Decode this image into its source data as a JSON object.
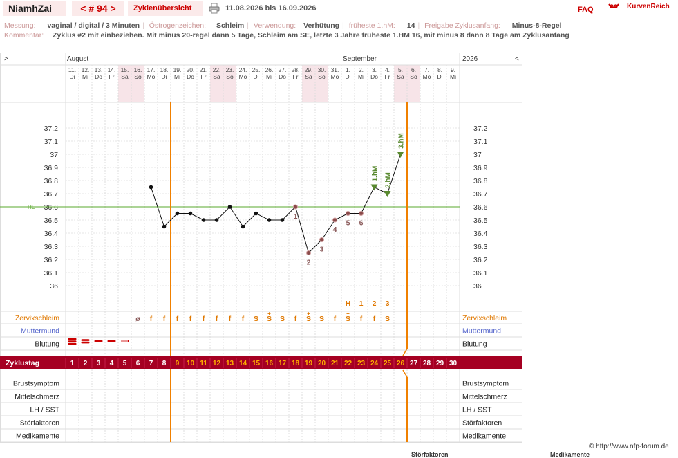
{
  "header": {
    "user": "NiamhZai",
    "cycle_nav": "< # 94 >",
    "overview_link": "Zyklenübersicht",
    "printer_icon": "printer-icon",
    "date_range": "11.08.2026 bis 16.09.2026",
    "faq": "FAQ",
    "logo_icon": "kurvenreich-logo-icon",
    "brand": "KurvenReich"
  },
  "info": {
    "messung_label": "Messung:",
    "messung_value": "vaginal / digital / 3 Minuten",
    "oestrogen_label": "Östrogenzeichen:",
    "oestrogen_value": "Schleim",
    "verwendung_label": "Verwendung:",
    "verwendung_value": "Verhütung",
    "frueheste_label": "früheste 1.hM:",
    "frueheste_value": "14",
    "freigabe_label": "Freigabe Zyklusanfang:",
    "freigabe_value": "Minus-8-Regel",
    "kommentar_label": "Kommentar:",
    "kommentar_value": "Zyklus #2  mit einbeziehen. Mit minus 20-regel dann 5 Tage,  Schleim am SE, letzte 3 Jahre früheste 1.HM 16, mit minus 8 dann 8 Tage am Zyklusanfang"
  },
  "colors": {
    "brand_red": "#cc0000",
    "cycle_bar": "#a50022",
    "weekend_shade": "#f7e4e8",
    "vertical_marker": "#f08000",
    "hl_line": "#5aa82c",
    "hm_marker": "#5a8a30",
    "mucus_orange": "#e07800",
    "muttermund_blue": "#5566cc",
    "bleeding_red": "#cc0000"
  },
  "chart_data": {
    "type": "line",
    "nav_left": ">",
    "nav_right": "<",
    "year": "2026",
    "months": [
      "August",
      "September"
    ],
    "days": [
      {
        "d": "11.",
        "w": "Di",
        "we": false
      },
      {
        "d": "12.",
        "w": "Mi",
        "we": false
      },
      {
        "d": "13.",
        "w": "Do",
        "we": false
      },
      {
        "d": "14.",
        "w": "Fr",
        "we": false
      },
      {
        "d": "15.",
        "w": "Sa",
        "we": true
      },
      {
        "d": "16.",
        "w": "So",
        "we": true
      },
      {
        "d": "17.",
        "w": "Mo",
        "we": false
      },
      {
        "d": "18.",
        "w": "Di",
        "we": false
      },
      {
        "d": "19.",
        "w": "Mi",
        "we": false
      },
      {
        "d": "20.",
        "w": "Do",
        "we": false
      },
      {
        "d": "21.",
        "w": "Fr",
        "we": false
      },
      {
        "d": "22.",
        "w": "Sa",
        "we": true
      },
      {
        "d": "23.",
        "w": "So",
        "we": true
      },
      {
        "d": "24.",
        "w": "Mo",
        "we": false
      },
      {
        "d": "25.",
        "w": "Di",
        "we": false
      },
      {
        "d": "26.",
        "w": "Mi",
        "we": false
      },
      {
        "d": "27.",
        "w": "Do",
        "we": false
      },
      {
        "d": "28.",
        "w": "Fr",
        "we": false
      },
      {
        "d": "29.",
        "w": "Sa",
        "we": true
      },
      {
        "d": "30.",
        "w": "So",
        "we": true
      },
      {
        "d": "31.",
        "w": "Mo",
        "we": false
      },
      {
        "d": "1.",
        "w": "Di",
        "we": false
      },
      {
        "d": "2.",
        "w": "Mi",
        "we": false
      },
      {
        "d": "3.",
        "w": "Do",
        "we": false
      },
      {
        "d": "4.",
        "w": "Fr",
        "we": false
      },
      {
        "d": "5.",
        "w": "Sa",
        "we": true
      },
      {
        "d": "6.",
        "w": "So",
        "we": true
      },
      {
        "d": "7.",
        "w": "Mo",
        "we": false
      },
      {
        "d": "8.",
        "w": "Di",
        "we": false
      },
      {
        "d": "9.",
        "w": "Mi",
        "we": false
      }
    ],
    "y_ticks": [
      "37.2",
      "37.1",
      "37",
      "36.9",
      "36.8",
      "36.7",
      "36.6",
      "36.5",
      "36.4",
      "36.3",
      "36.2",
      "36.1",
      "36"
    ],
    "ylim": [
      36.0,
      37.2
    ],
    "hl_label": "HL",
    "hl_value": 36.6,
    "temps": [
      {
        "day": 7,
        "t": 36.75
      },
      {
        "day": 8,
        "t": 36.45
      },
      {
        "day": 9,
        "t": 36.55
      },
      {
        "day": 10,
        "t": 36.55
      },
      {
        "day": 11,
        "t": 36.5
      },
      {
        "day": 12,
        "t": 36.5
      },
      {
        "day": 13,
        "t": 36.6
      },
      {
        "day": 14,
        "t": 36.45
      },
      {
        "day": 15,
        "t": 36.55
      },
      {
        "day": 16,
        "t": 36.5
      },
      {
        "day": 17,
        "t": 36.5
      },
      {
        "day": 18,
        "t": 36.6
      },
      {
        "day": 19,
        "t": 36.25
      },
      {
        "day": 20,
        "t": 36.35
      },
      {
        "day": 21,
        "t": 36.5
      },
      {
        "day": 22,
        "t": 36.55
      },
      {
        "day": 23,
        "t": 36.55
      },
      {
        "day": 24,
        "t": 36.75
      },
      {
        "day": 25,
        "t": 36.7
      },
      {
        "day": 26,
        "t": 37.0
      }
    ],
    "lower_marks": [
      {
        "day": 18,
        "label": "1"
      },
      {
        "day": 19,
        "label": "2"
      },
      {
        "day": 20,
        "label": "3"
      },
      {
        "day": 21,
        "label": "4"
      },
      {
        "day": 22,
        "label": "5"
      },
      {
        "day": 23,
        "label": "6"
      }
    ],
    "hm_marks": [
      {
        "day": 24,
        "label": "1.hM"
      },
      {
        "day": 25,
        "label": "2.hM"
      },
      {
        "day": 26,
        "label": "3.hM"
      }
    ],
    "vertical_markers_after_day": [
      8,
      26
    ],
    "peak_counts": [
      {
        "day": 22,
        "label": "H"
      },
      {
        "day": 23,
        "label": "1"
      },
      {
        "day": 24,
        "label": "2"
      },
      {
        "day": 25,
        "label": "3"
      }
    ],
    "mucus": [
      {
        "day": 6,
        "v": "ø"
      },
      {
        "day": 7,
        "v": "f"
      },
      {
        "day": 8,
        "v": "f"
      },
      {
        "day": 9,
        "v": "f"
      },
      {
        "day": 10,
        "v": "f"
      },
      {
        "day": 11,
        "v": "f"
      },
      {
        "day": 12,
        "v": "f"
      },
      {
        "day": 13,
        "v": "f"
      },
      {
        "day": 14,
        "v": "f"
      },
      {
        "day": 15,
        "v": "S"
      },
      {
        "day": 16,
        "v": "S+"
      },
      {
        "day": 17,
        "v": "S"
      },
      {
        "day": 18,
        "v": "f"
      },
      {
        "day": 19,
        "v": "S+"
      },
      {
        "day": 20,
        "v": "S"
      },
      {
        "day": 21,
        "v": "f"
      },
      {
        "day": 22,
        "v": "S+"
      },
      {
        "day": 23,
        "v": "f"
      },
      {
        "day": 24,
        "v": "f"
      },
      {
        "day": 25,
        "v": "S"
      }
    ],
    "bleeding": [
      {
        "day": 1,
        "level": "stark"
      },
      {
        "day": 2,
        "level": "mittel"
      },
      {
        "day": 3,
        "level": "normal"
      },
      {
        "day": 4,
        "level": "normal"
      },
      {
        "day": 5,
        "level": "schmier"
      }
    ],
    "row_labels": {
      "zervix": "Zervixschleim",
      "muttermund": "Muttermund",
      "blutung": "Blutung",
      "zyklustag": "Zyklustag",
      "brust": "Brustsymptom",
      "mittel": "Mittelschmerz",
      "lh": "LH / SST",
      "stoer": "Störfaktoren",
      "medi": "Medikamente"
    },
    "cycle_days": [
      "1",
      "2",
      "3",
      "4",
      "5",
      "6",
      "7",
      "8",
      "9",
      "10",
      "11",
      "12",
      "13",
      "14",
      "15",
      "16",
      "17",
      "18",
      "19",
      "20",
      "21",
      "22",
      "23",
      "24",
      "25",
      "26",
      "27",
      "28",
      "29",
      "30"
    ],
    "highlight_cycle_days_from": 9,
    "highlight_cycle_days_to": 26
  },
  "footer": {
    "copyright": "© http://www.nfp-forum.de",
    "cut_left": "Störfaktoren",
    "cut_right": "Medikamente"
  }
}
